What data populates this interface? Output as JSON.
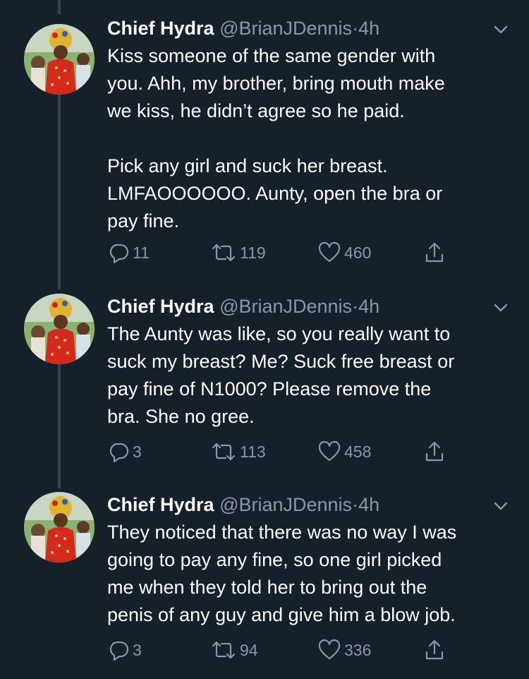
{
  "colors": {
    "background": "#15202b",
    "text": "#ffffff",
    "muted": "#8899a6",
    "thread_line": "#38444d"
  },
  "tweets": [
    {
      "author_name": "Chief Hydra",
      "handle": "@BrianJDennis",
      "separator": "·",
      "time": "4h",
      "text": "Kiss someone of the same gender with\nyou. Ahh, my brother, bring mouth make\nwe kiss, he didn’t agree so he paid.\n\nPick any girl and suck her breast.\nLMFAOOOOOO. Aunty, open the bra or\npay fine.",
      "replies": "11",
      "retweets": "119",
      "likes": "460"
    },
    {
      "author_name": "Chief Hydra",
      "handle": "@BrianJDennis",
      "separator": "·",
      "time": "4h",
      "text": "The Aunty was like, so you really want to\nsuck my breast? Me? Suck free breast or\npay fine of N1000? Please remove the\nbra. She no gree.",
      "replies": "3",
      "retweets": "113",
      "likes": "458"
    },
    {
      "author_name": "Chief Hydra",
      "handle": "@BrianJDennis",
      "separator": "·",
      "time": "4h",
      "text": "They noticed that there was no way I was\ngoing to pay any fine, so one girl picked\nme when they told her to bring out the\npenis of any guy and give him a blow job.",
      "replies": "3",
      "retweets": "94",
      "likes": "336"
    }
  ],
  "icons": {
    "reply": "reply-icon",
    "retweet": "retweet-icon",
    "like": "heart-icon",
    "share": "share-icon",
    "menu": "chevron-down-icon"
  }
}
